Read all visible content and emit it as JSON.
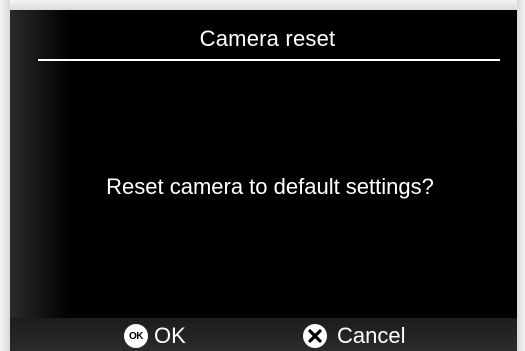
{
  "dialog": {
    "title": "Camera reset",
    "message": "Reset camera to default settings?"
  },
  "footer": {
    "ok_icon_text": "OK",
    "ok_label": "OK",
    "cancel_label": "Cancel"
  },
  "icons": {
    "ok": "ok-circle-icon",
    "cancel": "x-circle-icon"
  },
  "colors": {
    "background": "#000000",
    "text": "#ffffff",
    "footer_bar": "#222222"
  }
}
